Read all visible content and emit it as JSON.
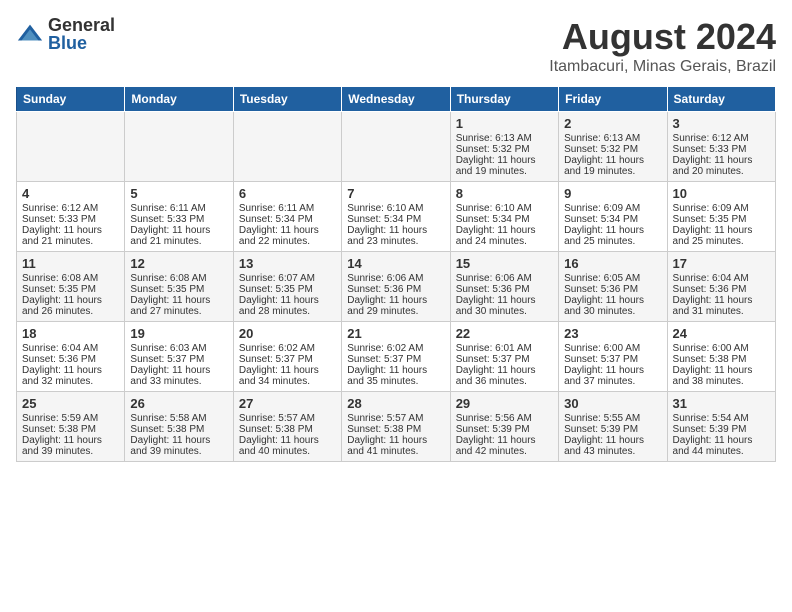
{
  "header": {
    "logo_general": "General",
    "logo_blue": "Blue",
    "month": "August 2024",
    "location": "Itambacuri, Minas Gerais, Brazil"
  },
  "days_of_week": [
    "Sunday",
    "Monday",
    "Tuesday",
    "Wednesday",
    "Thursday",
    "Friday",
    "Saturday"
  ],
  "weeks": [
    [
      {
        "day": "",
        "info": ""
      },
      {
        "day": "",
        "info": ""
      },
      {
        "day": "",
        "info": ""
      },
      {
        "day": "",
        "info": ""
      },
      {
        "day": "1",
        "info": "Sunrise: 6:13 AM\nSunset: 5:32 PM\nDaylight: 11 hours and 19 minutes."
      },
      {
        "day": "2",
        "info": "Sunrise: 6:13 AM\nSunset: 5:32 PM\nDaylight: 11 hours and 19 minutes."
      },
      {
        "day": "3",
        "info": "Sunrise: 6:12 AM\nSunset: 5:33 PM\nDaylight: 11 hours and 20 minutes."
      }
    ],
    [
      {
        "day": "4",
        "info": "Sunrise: 6:12 AM\nSunset: 5:33 PM\nDaylight: 11 hours and 21 minutes."
      },
      {
        "day": "5",
        "info": "Sunrise: 6:11 AM\nSunset: 5:33 PM\nDaylight: 11 hours and 21 minutes."
      },
      {
        "day": "6",
        "info": "Sunrise: 6:11 AM\nSunset: 5:34 PM\nDaylight: 11 hours and 22 minutes."
      },
      {
        "day": "7",
        "info": "Sunrise: 6:10 AM\nSunset: 5:34 PM\nDaylight: 11 hours and 23 minutes."
      },
      {
        "day": "8",
        "info": "Sunrise: 6:10 AM\nSunset: 5:34 PM\nDaylight: 11 hours and 24 minutes."
      },
      {
        "day": "9",
        "info": "Sunrise: 6:09 AM\nSunset: 5:34 PM\nDaylight: 11 hours and 25 minutes."
      },
      {
        "day": "10",
        "info": "Sunrise: 6:09 AM\nSunset: 5:35 PM\nDaylight: 11 hours and 25 minutes."
      }
    ],
    [
      {
        "day": "11",
        "info": "Sunrise: 6:08 AM\nSunset: 5:35 PM\nDaylight: 11 hours and 26 minutes."
      },
      {
        "day": "12",
        "info": "Sunrise: 6:08 AM\nSunset: 5:35 PM\nDaylight: 11 hours and 27 minutes."
      },
      {
        "day": "13",
        "info": "Sunrise: 6:07 AM\nSunset: 5:35 PM\nDaylight: 11 hours and 28 minutes."
      },
      {
        "day": "14",
        "info": "Sunrise: 6:06 AM\nSunset: 5:36 PM\nDaylight: 11 hours and 29 minutes."
      },
      {
        "day": "15",
        "info": "Sunrise: 6:06 AM\nSunset: 5:36 PM\nDaylight: 11 hours and 30 minutes."
      },
      {
        "day": "16",
        "info": "Sunrise: 6:05 AM\nSunset: 5:36 PM\nDaylight: 11 hours and 30 minutes."
      },
      {
        "day": "17",
        "info": "Sunrise: 6:04 AM\nSunset: 5:36 PM\nDaylight: 11 hours and 31 minutes."
      }
    ],
    [
      {
        "day": "18",
        "info": "Sunrise: 6:04 AM\nSunset: 5:36 PM\nDaylight: 11 hours and 32 minutes."
      },
      {
        "day": "19",
        "info": "Sunrise: 6:03 AM\nSunset: 5:37 PM\nDaylight: 11 hours and 33 minutes."
      },
      {
        "day": "20",
        "info": "Sunrise: 6:02 AM\nSunset: 5:37 PM\nDaylight: 11 hours and 34 minutes."
      },
      {
        "day": "21",
        "info": "Sunrise: 6:02 AM\nSunset: 5:37 PM\nDaylight: 11 hours and 35 minutes."
      },
      {
        "day": "22",
        "info": "Sunrise: 6:01 AM\nSunset: 5:37 PM\nDaylight: 11 hours and 36 minutes."
      },
      {
        "day": "23",
        "info": "Sunrise: 6:00 AM\nSunset: 5:37 PM\nDaylight: 11 hours and 37 minutes."
      },
      {
        "day": "24",
        "info": "Sunrise: 6:00 AM\nSunset: 5:38 PM\nDaylight: 11 hours and 38 minutes."
      }
    ],
    [
      {
        "day": "25",
        "info": "Sunrise: 5:59 AM\nSunset: 5:38 PM\nDaylight: 11 hours and 39 minutes."
      },
      {
        "day": "26",
        "info": "Sunrise: 5:58 AM\nSunset: 5:38 PM\nDaylight: 11 hours and 39 minutes."
      },
      {
        "day": "27",
        "info": "Sunrise: 5:57 AM\nSunset: 5:38 PM\nDaylight: 11 hours and 40 minutes."
      },
      {
        "day": "28",
        "info": "Sunrise: 5:57 AM\nSunset: 5:38 PM\nDaylight: 11 hours and 41 minutes."
      },
      {
        "day": "29",
        "info": "Sunrise: 5:56 AM\nSunset: 5:39 PM\nDaylight: 11 hours and 42 minutes."
      },
      {
        "day": "30",
        "info": "Sunrise: 5:55 AM\nSunset: 5:39 PM\nDaylight: 11 hours and 43 minutes."
      },
      {
        "day": "31",
        "info": "Sunrise: 5:54 AM\nSunset: 5:39 PM\nDaylight: 11 hours and 44 minutes."
      }
    ]
  ]
}
